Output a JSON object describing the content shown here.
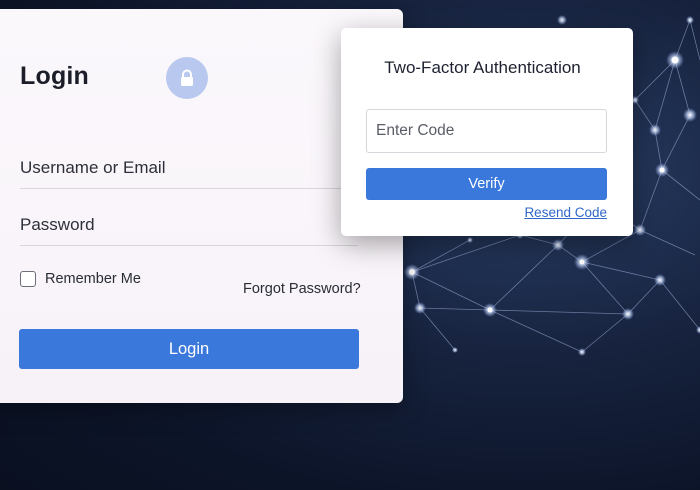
{
  "login": {
    "title": "Login",
    "username_placeholder": "Username or Email",
    "password_placeholder": "Password",
    "remember_label": "Remember Me",
    "forgot_label": "Forgot Password?",
    "submit_label": "Login",
    "icon": "lock-icon"
  },
  "two_factor": {
    "title": "Two-Factor Authentication",
    "code_placeholder": "Enter Code",
    "verify_label": "Verify",
    "resend_label": "Resend Code"
  },
  "colors": {
    "primary": "#3b78db",
    "link": "#3167c9",
    "lock_badge": "#b9c8ee",
    "background": "#0c1428"
  }
}
